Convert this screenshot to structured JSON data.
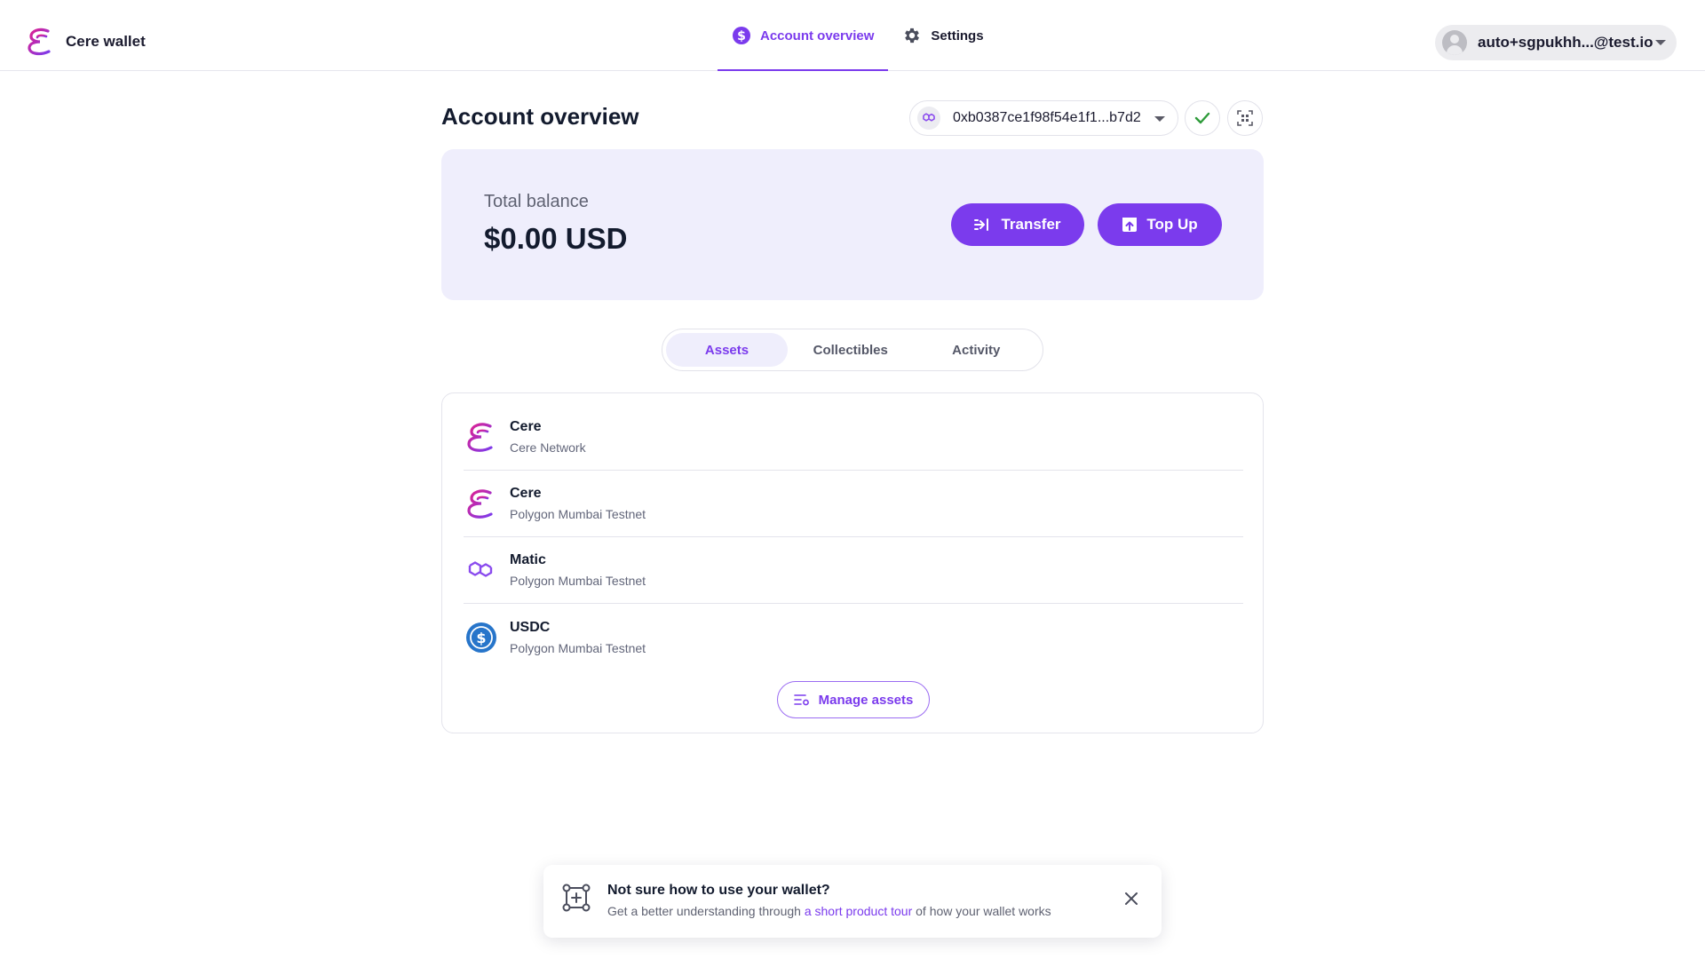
{
  "app": {
    "name": "Cere wallet"
  },
  "nav": {
    "tabs": [
      {
        "label": "Account overview",
        "active": true,
        "icon": "dollar-circle-icon"
      },
      {
        "label": "Settings",
        "active": false,
        "icon": "gear-icon"
      }
    ]
  },
  "account": {
    "email": "auto+sgpukhh...@test.io"
  },
  "page": {
    "title": "Account overview"
  },
  "address": {
    "value": "0xb0387ce1f98f54e1f1...b7d2",
    "chain_icon": "polygon-icon"
  },
  "balance": {
    "label": "Total balance",
    "value": "$0.00 USD"
  },
  "actions": {
    "transfer_label": "Transfer",
    "topup_label": "Top Up"
  },
  "tabs": [
    {
      "label": "Assets",
      "active": true
    },
    {
      "label": "Collectibles",
      "active": false
    },
    {
      "label": "Activity",
      "active": false
    }
  ],
  "assets": [
    {
      "name": "Cere",
      "network": "Cere Network",
      "icon": "cere-icon"
    },
    {
      "name": "Cere",
      "network": "Polygon Mumbai Testnet",
      "icon": "cere-icon"
    },
    {
      "name": "Matic",
      "network": "Polygon Mumbai Testnet",
      "icon": "polygon-icon"
    },
    {
      "name": "USDC",
      "network": "Polygon Mumbai Testnet",
      "icon": "usdc-icon"
    }
  ],
  "manage_assets_label": "Manage assets",
  "tour": {
    "title": "Not sure how to use your wallet?",
    "body_before": "Get a better understanding through ",
    "link": "a short product tour",
    "body_after": " of how your wallet works"
  },
  "colors": {
    "accent": "#7b3bed",
    "card_bg": "#efeefc",
    "success": "#2e9b3a",
    "usdc": "#2775ca"
  }
}
